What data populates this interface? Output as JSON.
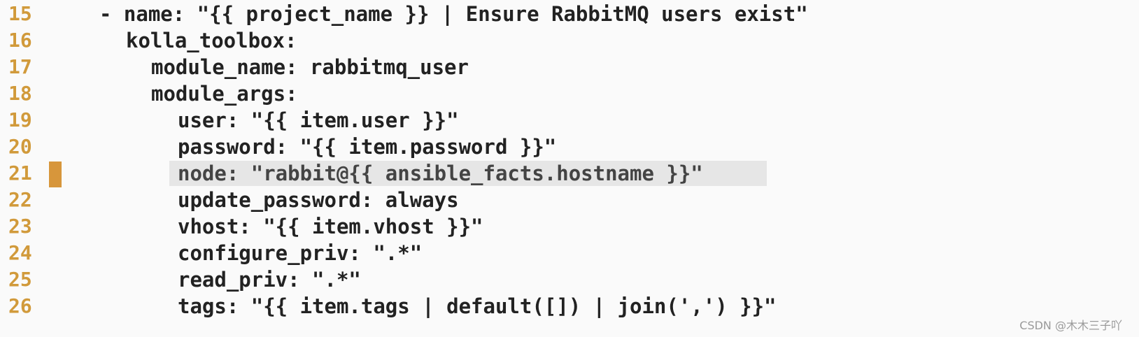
{
  "lines": [
    {
      "number": "15",
      "text": "- name: \"{{ project_name }} | Ensure RabbitMQ users exist\""
    },
    {
      "number": "16",
      "text": "kolla_toolbox:"
    },
    {
      "number": "17",
      "text": "module_name: rabbitmq_user"
    },
    {
      "number": "18",
      "text": "module_args:"
    },
    {
      "number": "19",
      "text": "user: \"{{ item.user }}\""
    },
    {
      "number": "20",
      "text": "password: \"{{ item.password }}\""
    },
    {
      "number": "21",
      "text": "node: \"rabbit@{{ ansible_facts.hostname }}\""
    },
    {
      "number": "22",
      "text": "update_password: always"
    },
    {
      "number": "23",
      "text": "vhost: \"{{ item.vhost }}\""
    },
    {
      "number": "24",
      "text": "configure_priv: \".*\""
    },
    {
      "number": "25",
      "text": "read_priv: \".*\""
    },
    {
      "number": "26",
      "text": "tags: \"{{ item.tags | default([]) | join(',') }}\""
    }
  ],
  "highlighted_line": "21",
  "watermark": "CSDN @木木三子吖",
  "colors": {
    "line_number": "#d19a3b",
    "change_marker": "#d7963b",
    "highlight_background": "#e6e6e6",
    "code_text": "#222222",
    "background": "#fafafa"
  }
}
